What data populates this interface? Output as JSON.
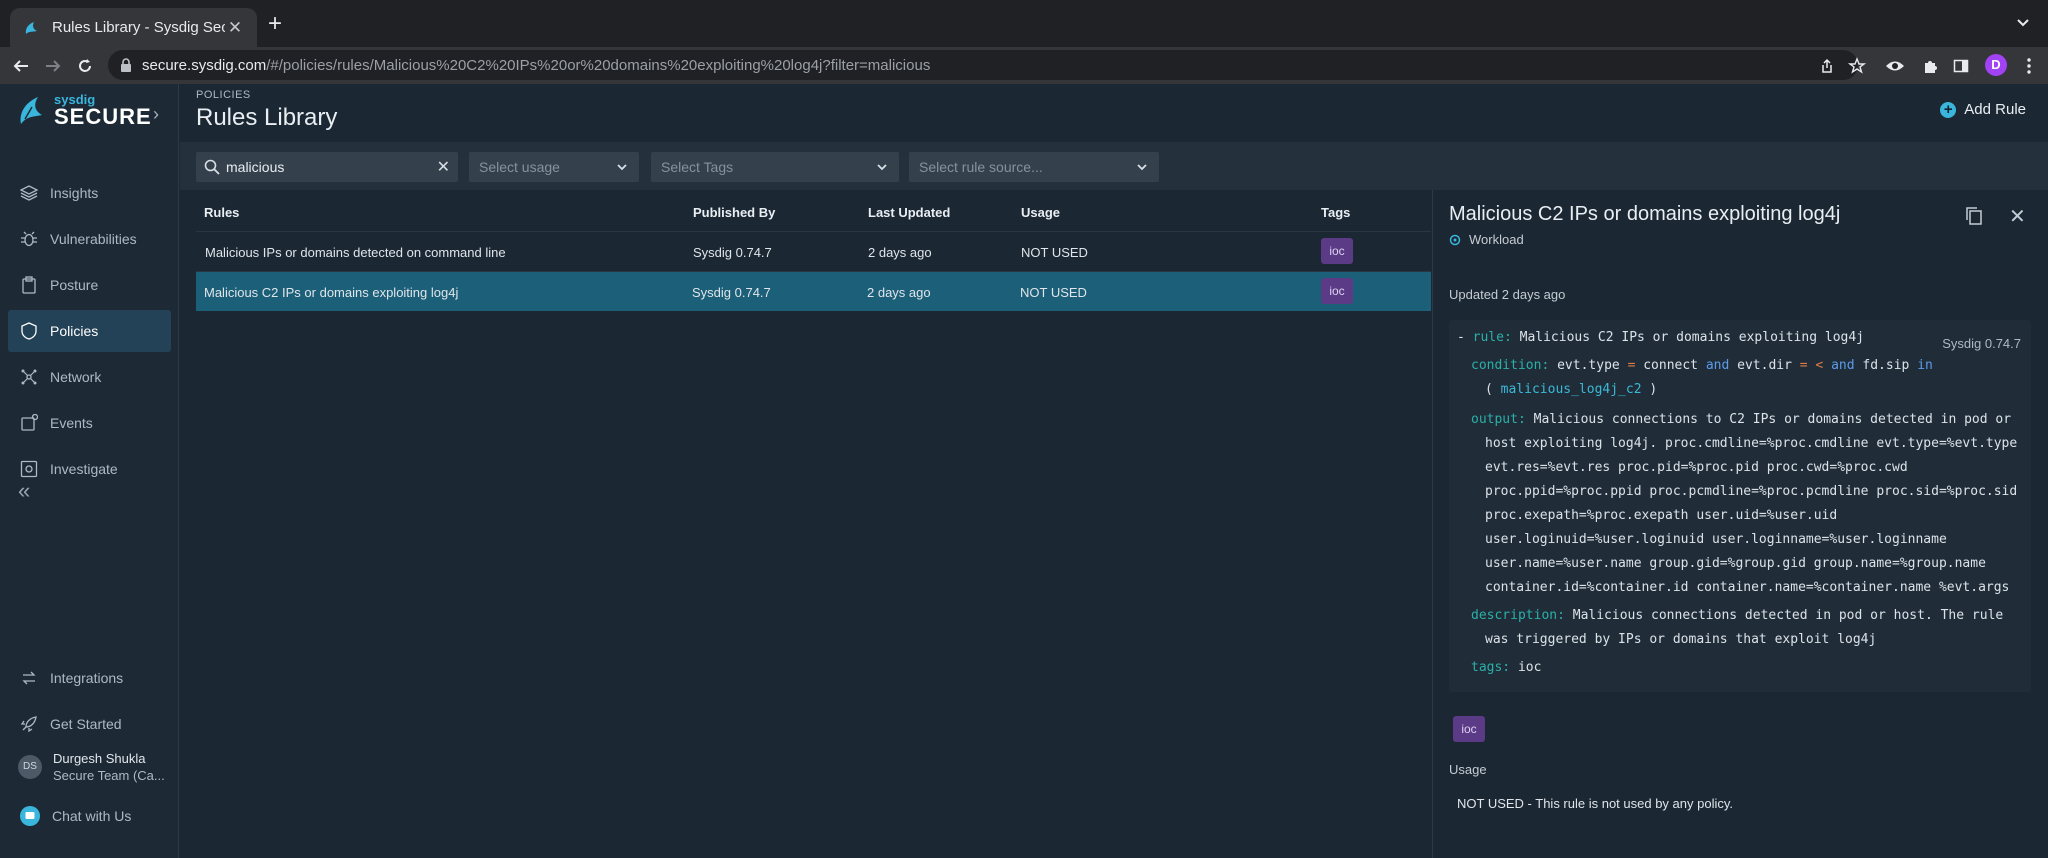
{
  "browser": {
    "tab_title": "Rules Library - Sysdig Secure",
    "url_host": "secure.sysdig.com",
    "url_path": "/#/policies/rules/Malicious%20C2%20IPs%20or%20domains%20exploiting%20log4j?filter=malicious",
    "profile_initial": "D"
  },
  "sidebar": {
    "brand_small": "sysdig",
    "brand_big": "SECURE",
    "items": [
      {
        "label": "Insights",
        "icon": "layers-icon"
      },
      {
        "label": "Vulnerabilities",
        "icon": "bug-icon"
      },
      {
        "label": "Posture",
        "icon": "clipboard-icon"
      },
      {
        "label": "Policies",
        "icon": "shield-icon",
        "active": true
      },
      {
        "label": "Network",
        "icon": "network-icon"
      },
      {
        "label": "Events",
        "icon": "events-icon"
      },
      {
        "label": "Investigate",
        "icon": "investigate-icon"
      }
    ],
    "bottom_items": [
      {
        "label": "Integrations",
        "icon": "integrations-icon"
      },
      {
        "label": "Get Started",
        "icon": "rocket-icon"
      }
    ],
    "user": {
      "initials": "DS",
      "name": "Durgesh Shukla",
      "team": "Secure Team (Ca..."
    },
    "chat": "Chat with Us"
  },
  "header": {
    "breadcrumb": "POLICIES",
    "title": "Rules Library",
    "add_rule": "Add Rule"
  },
  "filters": {
    "search_value": "malicious",
    "usage_placeholder": "Select usage",
    "tags_placeholder": "Select Tags",
    "source_placeholder": "Select rule source..."
  },
  "table": {
    "columns": [
      "Rules",
      "Published By",
      "Last Updated",
      "Usage",
      "Tags"
    ],
    "rows": [
      {
        "rule": "Malicious IPs or domains detected on command line",
        "published_by": "Sysdig 0.74.7",
        "last_updated": "2 days ago",
        "usage": "NOT USED",
        "tag": "ioc"
      },
      {
        "rule": "Malicious C2 IPs or domains exploiting log4j",
        "published_by": "Sysdig 0.74.7",
        "last_updated": "2 days ago",
        "usage": "NOT USED",
        "tag": "ioc"
      }
    ]
  },
  "detail": {
    "title": "Malicious C2 IPs or domains exploiting log4j",
    "type": "Workload",
    "updated": "Updated 2 days ago",
    "version": "Sysdig 0.74.7",
    "code": {
      "rule_key": "rule:",
      "rule_value": "Malicious C2 IPs or domains exploiting log4j",
      "condition_key": "condition:",
      "cond_1": "evt.type",
      "cond_eq": "=",
      "cond_2": "connect",
      "cond_and1": "and",
      "cond_3": "evt.dir",
      "cond_eq2": "= <",
      "cond_and2": "and",
      "cond_4": "fd.sip",
      "cond_in": "in",
      "cond_list": "malicious_log4j_c2",
      "output_key": "output:",
      "output_lines": [
        "Malicious connections to C2 IPs or domains detected in pod or",
        "host exploiting log4j. proc.cmdline=%proc.cmdline evt.type=%evt.type",
        "evt.res=%evt.res proc.pid=%proc.pid proc.cwd=%proc.cwd",
        "proc.ppid=%proc.ppid proc.pcmdline=%proc.pcmdline proc.sid=%proc.sid",
        "proc.exepath=%proc.exepath user.uid=%user.uid",
        "user.loginuid=%user.loginuid user.loginname=%user.loginname",
        "user.name=%user.name group.gid=%group.gid group.name=%group.name",
        "container.id=%container.id container.name=%container.name %evt.args"
      ],
      "description_key": "description:",
      "description_lines": [
        "Malicious connections detected in pod or host. The rule",
        "was triggered by IPs or domains that exploit log4j"
      ],
      "tags_key": "tags:",
      "tags_value": "ioc"
    },
    "tag": "ioc",
    "usage_label": "Usage",
    "usage_text": "NOT USED - This rule is not used by any policy."
  }
}
